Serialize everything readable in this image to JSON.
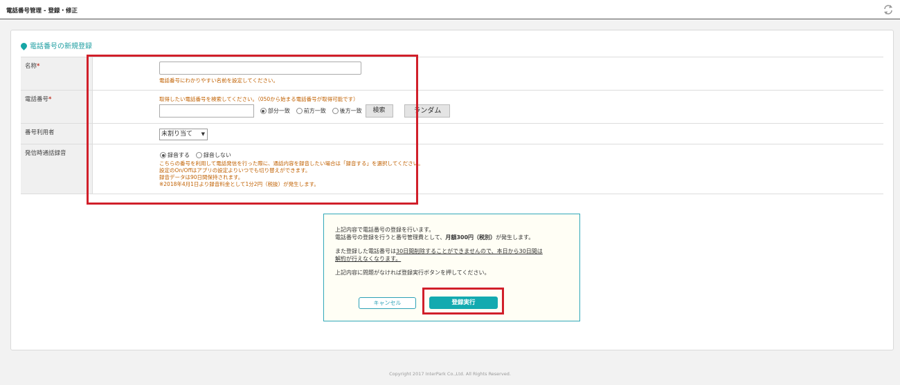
{
  "header": {
    "title": "電話番号管理 - 登録・修正",
    "sync_icon": "sync-arrows-icon"
  },
  "section": {
    "title": "電話番号の新規登録"
  },
  "form": {
    "name": {
      "label": "名称",
      "required": "*",
      "value": "",
      "hint": "電話番号にわかりやすい名前を設定してください。"
    },
    "phone": {
      "label": "電話番号",
      "required": "*",
      "hint": "取得したい電話番号を検索してください。（050から始まる電話番号が取得可能です）",
      "value": "",
      "match_options": [
        "部分一致",
        "前方一致",
        "後方一致"
      ],
      "selected_match": "部分一致",
      "search_label": "検索",
      "random_label": "ランダム"
    },
    "user": {
      "label": "番号利用者",
      "selected": "未割り当て"
    },
    "recording": {
      "label": "発信時通話録音",
      "options": [
        "録音する",
        "録音しない"
      ],
      "selected": "録音する",
      "notes": [
        "こちらの番号を利用して電話発信を行った際に、通話内容を録音したい場合は「録音する」を選択してください。",
        "設定のOn/Offはアプリの設定よりいつでも切り替えができます。",
        "録音データは90日間保持されます。",
        "※2018年4月1日より録音料金として1分2円（税抜）が発生します。"
      ]
    }
  },
  "confirm": {
    "line1": "上記内容で電話番号の登録を行います。",
    "line2_pre": "電話番号の登録を行うと番号管理費として、",
    "line2_bold": "月額300円（税別）",
    "line2_post": "が発生します。",
    "line3_pre": "また登録した電話番号は",
    "line3_u": "30日間削除することができませんので、本日から30日間は",
    "line4_u": "解約が行えなくなります。",
    "line5": "上記内容に問題がなければ登録実行ボタンを押してください。",
    "cancel_label": "キャンセル",
    "submit_label": "登録実行"
  },
  "footer": {
    "copyright": "Copyright 2017 InterPark Co.,Ltd. All Rights Reserved."
  },
  "colors": {
    "accent": "#13aab0",
    "highlight": "#d11f2a",
    "hint": "#c06000"
  }
}
